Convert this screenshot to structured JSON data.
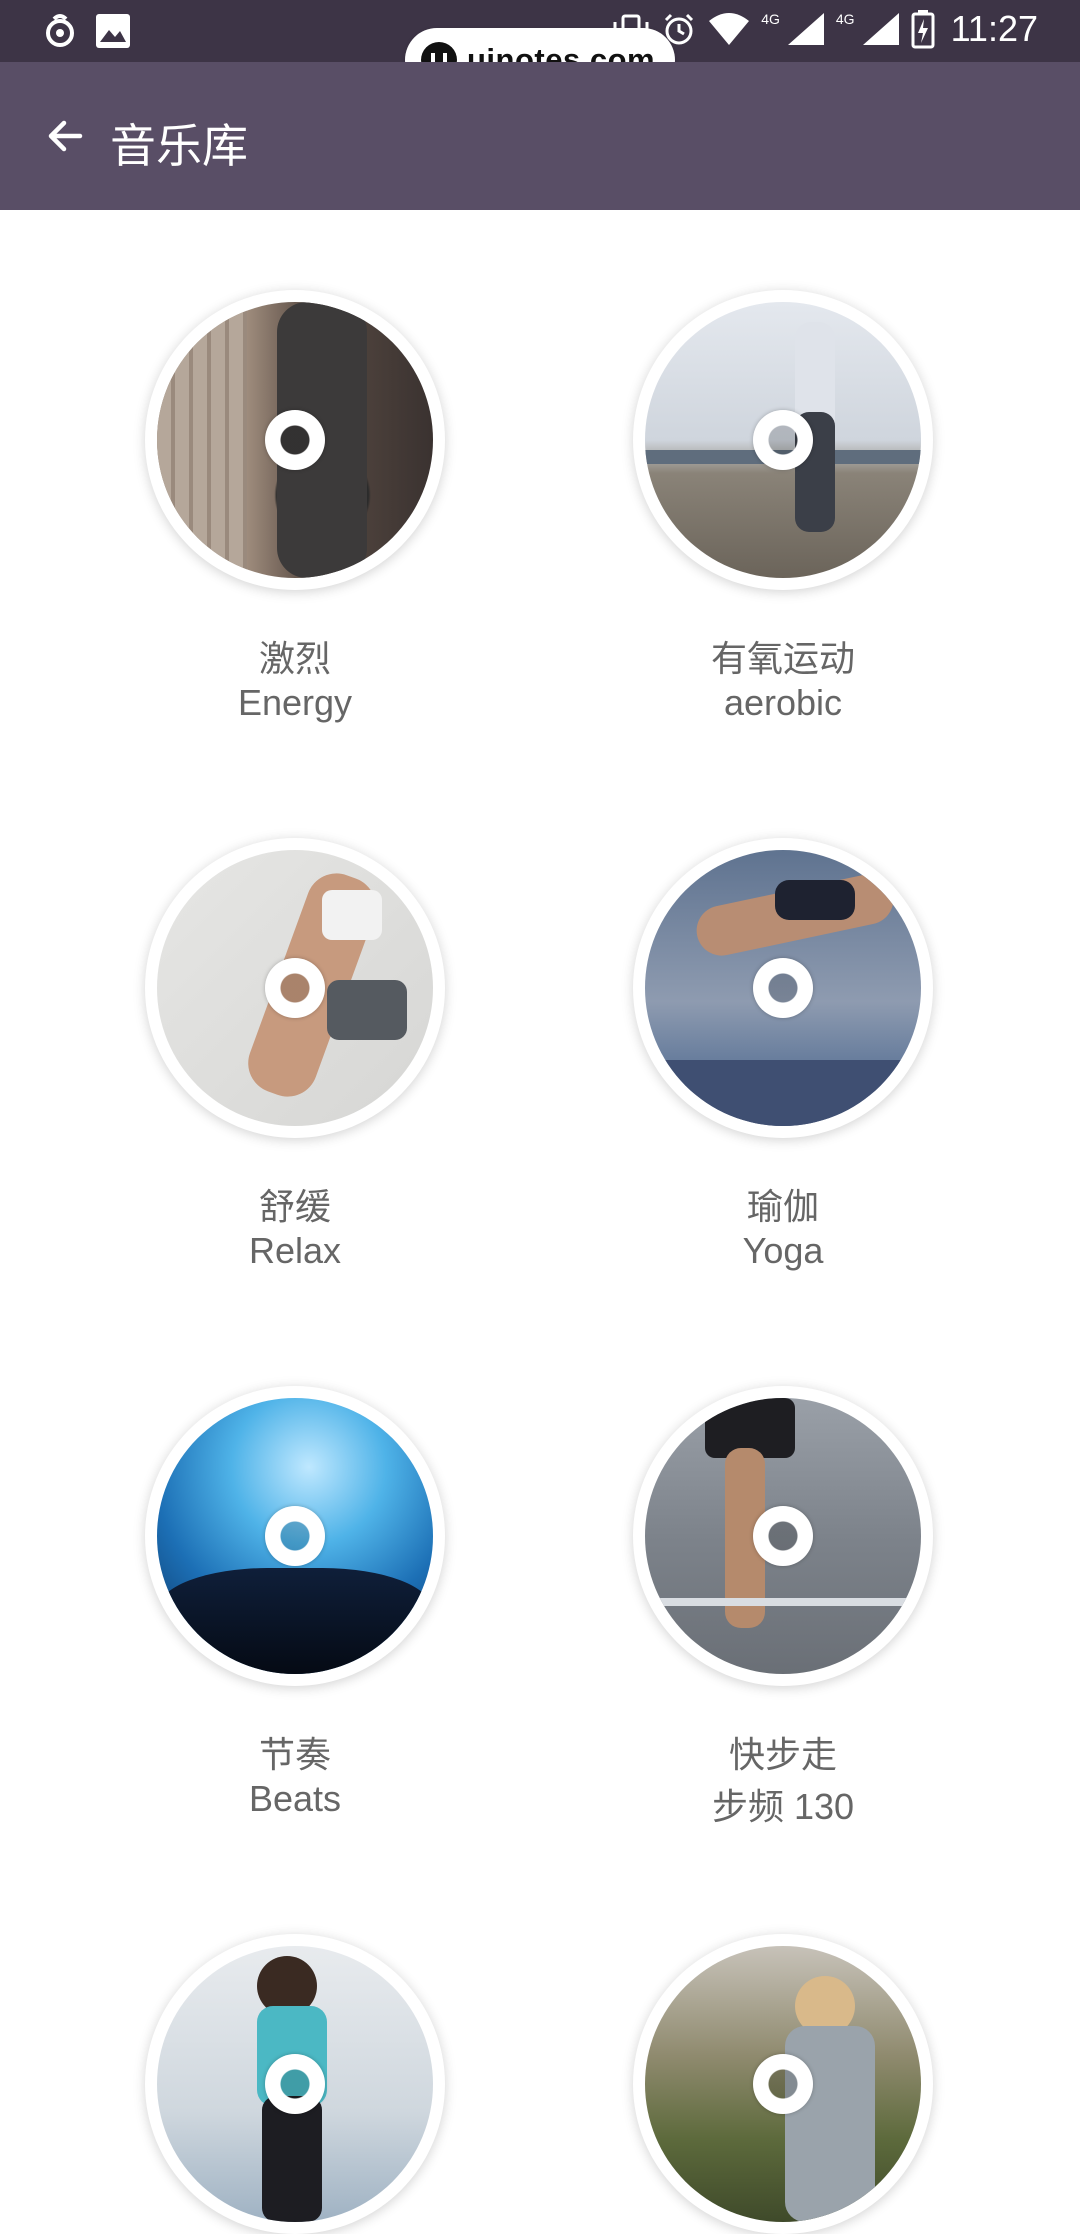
{
  "status": {
    "time": "11:27",
    "net1": "4G",
    "net2": "4G"
  },
  "watermark": {
    "text": "uinotes.com"
  },
  "app_bar": {
    "title": "音乐库"
  },
  "playlists": [
    {
      "cn": "激烈",
      "en": "Energy"
    },
    {
      "cn": "有氧运动",
      "en": "aerobic"
    },
    {
      "cn": "舒缓",
      "en": "Relax"
    },
    {
      "cn": "瑜伽",
      "en": "Yoga"
    },
    {
      "cn": "节奏",
      "en": "Beats"
    },
    {
      "cn": "快步走",
      "en": "步频 130"
    },
    {
      "cn": "",
      "en": ""
    },
    {
      "cn": "",
      "en": ""
    }
  ],
  "colors": {
    "status_bar": "#3d3446",
    "app_bar": "#594e66",
    "label": "#666666"
  }
}
